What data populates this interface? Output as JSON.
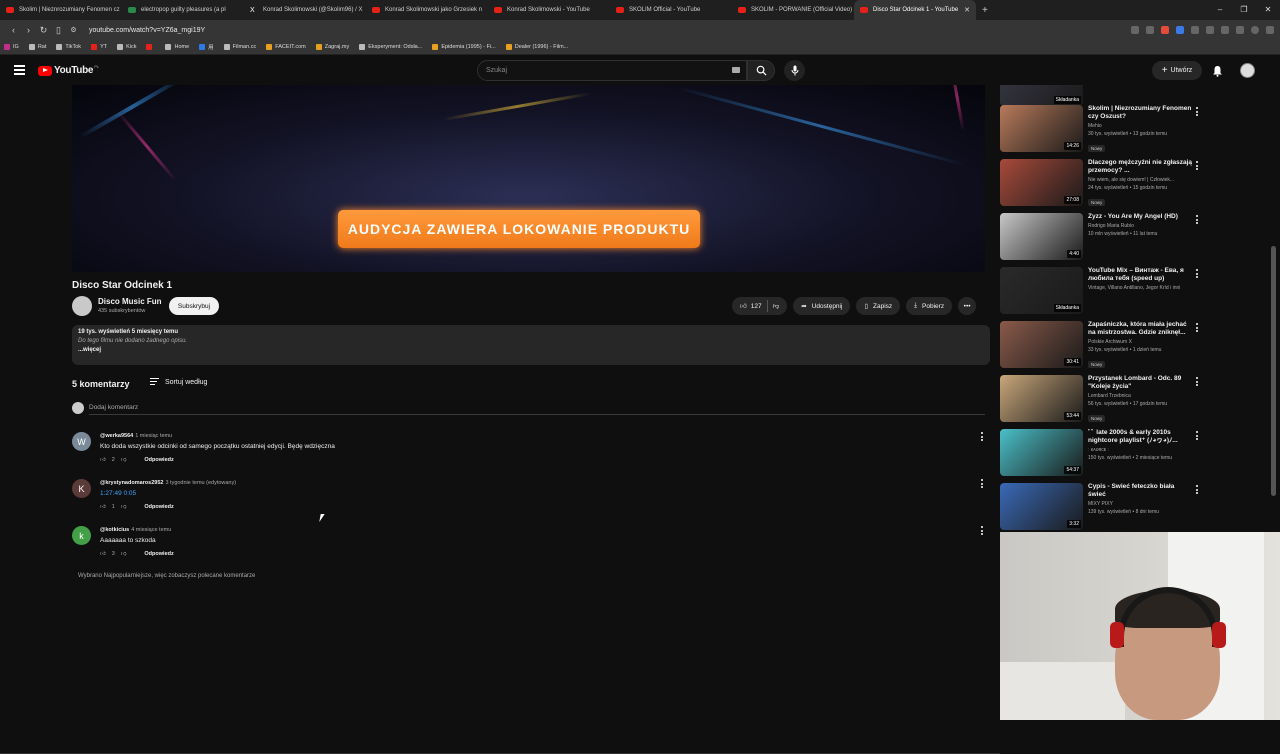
{
  "browser": {
    "tabs": [
      {
        "title": "Skolim | Nieznrozumiany Fenomen cz",
        "icon": "youtube-icon",
        "active": false
      },
      {
        "title": "electropop guilty pleasures (a pl",
        "icon": "youtube-icon",
        "active": false
      },
      {
        "title": "Konrad Skolimowski (@Skolim96) / X",
        "icon": "x-icon",
        "active": false
      },
      {
        "title": "Konrad Skolimowski jako Grzesiek n",
        "icon": "youtube-icon",
        "active": false
      },
      {
        "title": "Konrad Skolimowski - YouTube",
        "icon": "youtube-icon",
        "active": false
      },
      {
        "title": "SKOLIM Official - YouTube",
        "icon": "youtube-icon",
        "active": false
      },
      {
        "title": "SKOLIM - PORWANIE (Official Video)",
        "icon": "youtube-icon",
        "active": false
      },
      {
        "title": "Disco Star Odcinek 1 - YouTube",
        "icon": "youtube-icon",
        "active": true
      }
    ],
    "new_tab": "+",
    "url": "youtube.com/watch?v=YZ6a_mgi19Y",
    "bookmarks": [
      "IG",
      "Rat",
      "TikTok",
      "YT",
      "Kick",
      "",
      "Home",
      "用",
      "Filman.cc",
      "FACEIT.com",
      "Zagraj.my",
      "Eksperyment: Odsła...",
      "Epidemia (1995) - Fi...",
      "Dealer (1996) - Film..."
    ]
  },
  "youtube": {
    "logo": "YouTube",
    "logo_region": "PL",
    "search_placeholder": "Szukaj",
    "create_label": "Utwórz",
    "video": {
      "banner_text": "AUDYCJA ZAWIERA LOKOWANIE PRODUKTU",
      "title": "Disco Star Odcinek 1",
      "channel": "Disco Music Fun",
      "subscribers": "435 subskrybentów",
      "subscribe_label": "Subskrybuj",
      "likes": "127",
      "share_label": "Udostępnij",
      "save_label": "Zapisz",
      "download_label": "Pobierz",
      "description": {
        "stats": "19 tys. wyświetleń  5 miesięcy temu",
        "text": "Do tego filmu nie dodano żadnego opisu.",
        "more": "...więcej"
      }
    },
    "comments": {
      "count_label": "5 komentarzy",
      "sort_label": "Sortuj według",
      "add_placeholder": "Dodaj komentarz",
      "items": [
        {
          "avatar": "W",
          "avatar_color": "#7a8a99",
          "author": "@werka9564",
          "time": "1 miesiąc temu",
          "text": "Kto doda wszystkie odcinki od samego początku ostatniej edycji. Będę wdzięczna",
          "likes": "2",
          "reply": "Odpowiedz",
          "is_link": false
        },
        {
          "avatar": "K",
          "avatar_color": "#5b3a3a",
          "author": "@krystynadomaros2952",
          "time": "3 tygodnie temu (edytowany)",
          "text": "1:27:49 0:05",
          "likes": "1",
          "reply": "Odpowiedz",
          "is_link": true
        },
        {
          "avatar": "k",
          "avatar_color": "#43a047",
          "author": "@kotkicius",
          "time": "4 miesiące temu",
          "text": "Aaaaaaa to szkoda",
          "likes": "3",
          "reply": "Odpowiedz",
          "is_link": false
        }
      ],
      "footnote": "Wybrano Najpopularniejsze, więc zobaczysz polecane komentarze"
    },
    "recommendations": [
      {
        "title": "",
        "channel": "",
        "meta": "",
        "duration": "Składanka",
        "new": "",
        "thumb": "#3a3a48"
      },
      {
        "title": "Skolim | Niezrozumiany Fenomen czy Oszust?",
        "channel": "Mehio",
        "meta": "30 tys. wyświetleń • 13 godzin temu",
        "duration": "14:26",
        "new": "Nowy",
        "thumb": "#b87a5a"
      },
      {
        "title": "Dlaczego mężczyźni nie zgłaszają przemocy? ...",
        "channel": "Nie wiem, ale się dowiem! | Człowiek...",
        "meta": "24 tys. wyświetleń • 15 godzin temu",
        "duration": "27:08",
        "new": "Nowy",
        "thumb": "#a84a3a"
      },
      {
        "title": "Zyzz - You Are My Angel (HD)",
        "channel": "Rodrigo Maria Rubio",
        "meta": "10 mln wyświetleń • 11 lat temu",
        "duration": "4:40",
        "new": "",
        "thumb": "#c8c8c8"
      },
      {
        "title": "YouTube Mix – Винтаж - Ева, я любила тебя (speed up)",
        "channel": "Vintage, Villano Antillano, Jegor Kríd i inni",
        "meta": "",
        "duration": "Składanka",
        "new": "",
        "thumb": "#2a2a2a"
      },
      {
        "title": "Zapaśniczka, która miała jechać na mistrzostwa. Gdzie zniknęł...",
        "channel": "Polskie Archiwum X",
        "meta": "33 tys. wyświetleń • 1 dzień temu",
        "duration": "30:41",
        "new": "Nowy",
        "thumb": "#8a5a4a"
      },
      {
        "title": "Przystanek Lombard - Odc. 89 \"Koleje życia\"",
        "channel": "Lombard Trzebnica",
        "meta": "56 tys. wyświetleń • 17 godzin temu",
        "duration": "53:44",
        "new": "Nowy",
        "thumb": "#c9a77a"
      },
      {
        "title": "ﾟﾟ late 2000s & early 2010s nightcore playlist⁺ (ﾉ◕ヮ◕)ﾉ...",
        "channel": "ː ᴋᴀᴜʀᴄᴇ ː",
        "meta": "150 tys. wyświetleń • 2 miesiące temu",
        "duration": "54:37",
        "new": "",
        "thumb": "#4ac0c8"
      },
      {
        "title": "Cypis - Świeć feteczko biała świeć",
        "channel": "MIXY PIXY",
        "meta": "139 tys. wyświetleń • 8 dni temu",
        "duration": "3:32",
        "new": "",
        "thumb": "#3a6ab8"
      }
    ]
  },
  "colors": {
    "bg": "#0f0f0f",
    "accent": "#ff0000",
    "link": "#3ea6ff",
    "banner": "#f58a2a"
  }
}
